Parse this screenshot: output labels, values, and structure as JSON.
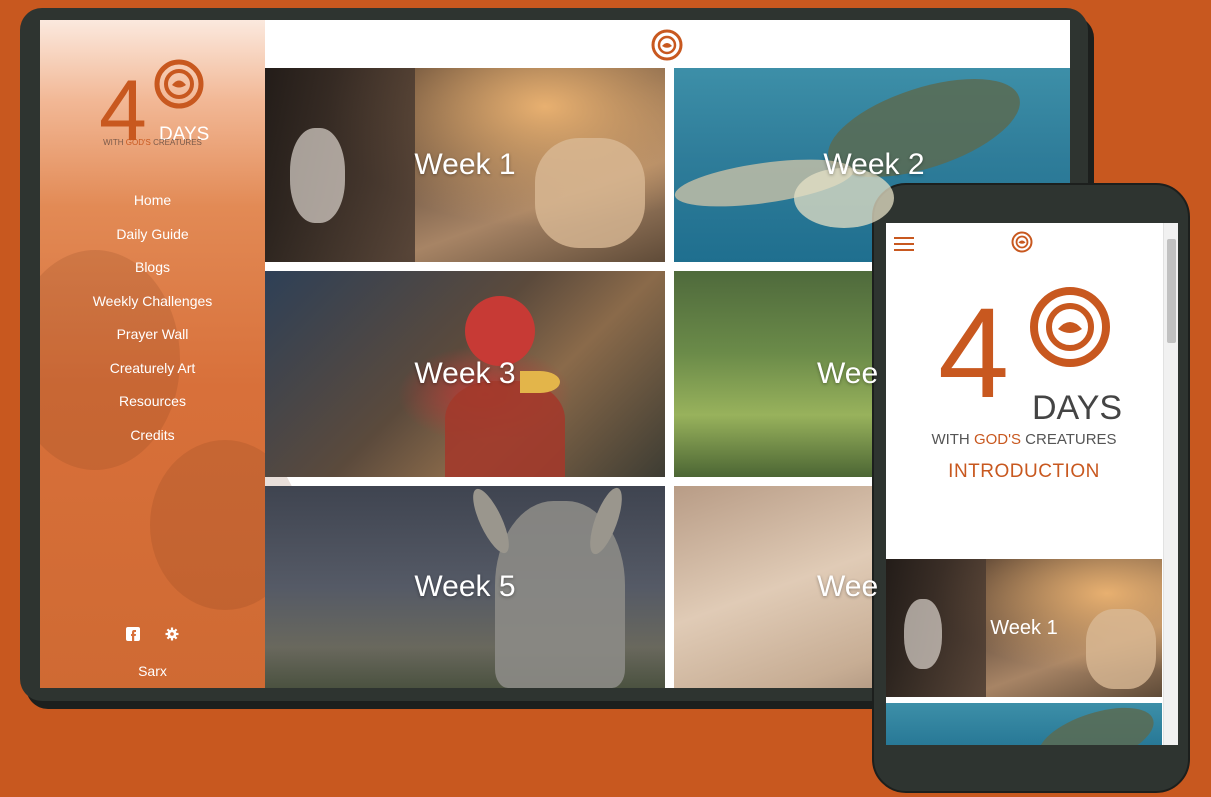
{
  "brand": {
    "number": "4",
    "days": "DAYS",
    "tagline_prefix": "WITH",
    "tagline_highlight": "GOD'S",
    "tagline_suffix": "CREATURES",
    "colors": {
      "primary": "#c8581f",
      "frame": "#2e3430",
      "text_on_dark": "#ffffff"
    }
  },
  "sidebar": {
    "nav": [
      {
        "label": "Home"
      },
      {
        "label": "Daily Guide"
      },
      {
        "label": "Blogs"
      },
      {
        "label": "Weekly Challenges"
      },
      {
        "label": "Prayer Wall"
      },
      {
        "label": "Creaturely Art"
      },
      {
        "label": "Resources"
      },
      {
        "label": "Credits"
      }
    ],
    "icons": [
      "facebook-icon",
      "gear-icon"
    ],
    "user": "Sarx"
  },
  "tiles": [
    {
      "label": "Week 1"
    },
    {
      "label": "Week 2"
    },
    {
      "label": "Week 3"
    },
    {
      "label": "Wee"
    },
    {
      "label": "Week 5"
    },
    {
      "label": "Wee"
    }
  ],
  "phone": {
    "page_title": "INTRODUCTION",
    "tiles": [
      {
        "label": "Week 1"
      }
    ]
  }
}
